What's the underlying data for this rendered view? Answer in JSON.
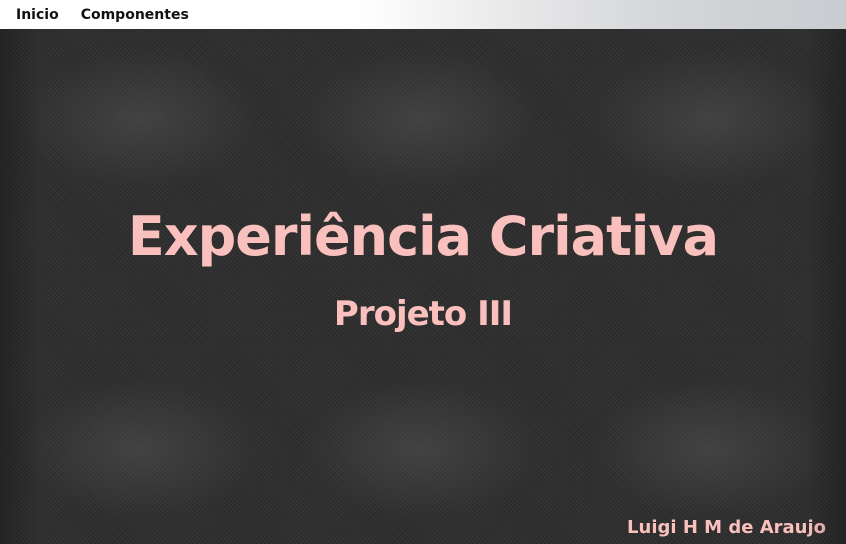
{
  "nav": {
    "items": [
      {
        "label": "Inicio"
      },
      {
        "label": "Componentes"
      }
    ]
  },
  "hero": {
    "title": "Experiência Criativa",
    "subtitle": "Projeto III",
    "author": "Luigi H M de Araujo"
  },
  "colors": {
    "accent_text": "#f9c0bd",
    "background": "#302f2f",
    "nav_text": "#111111"
  }
}
